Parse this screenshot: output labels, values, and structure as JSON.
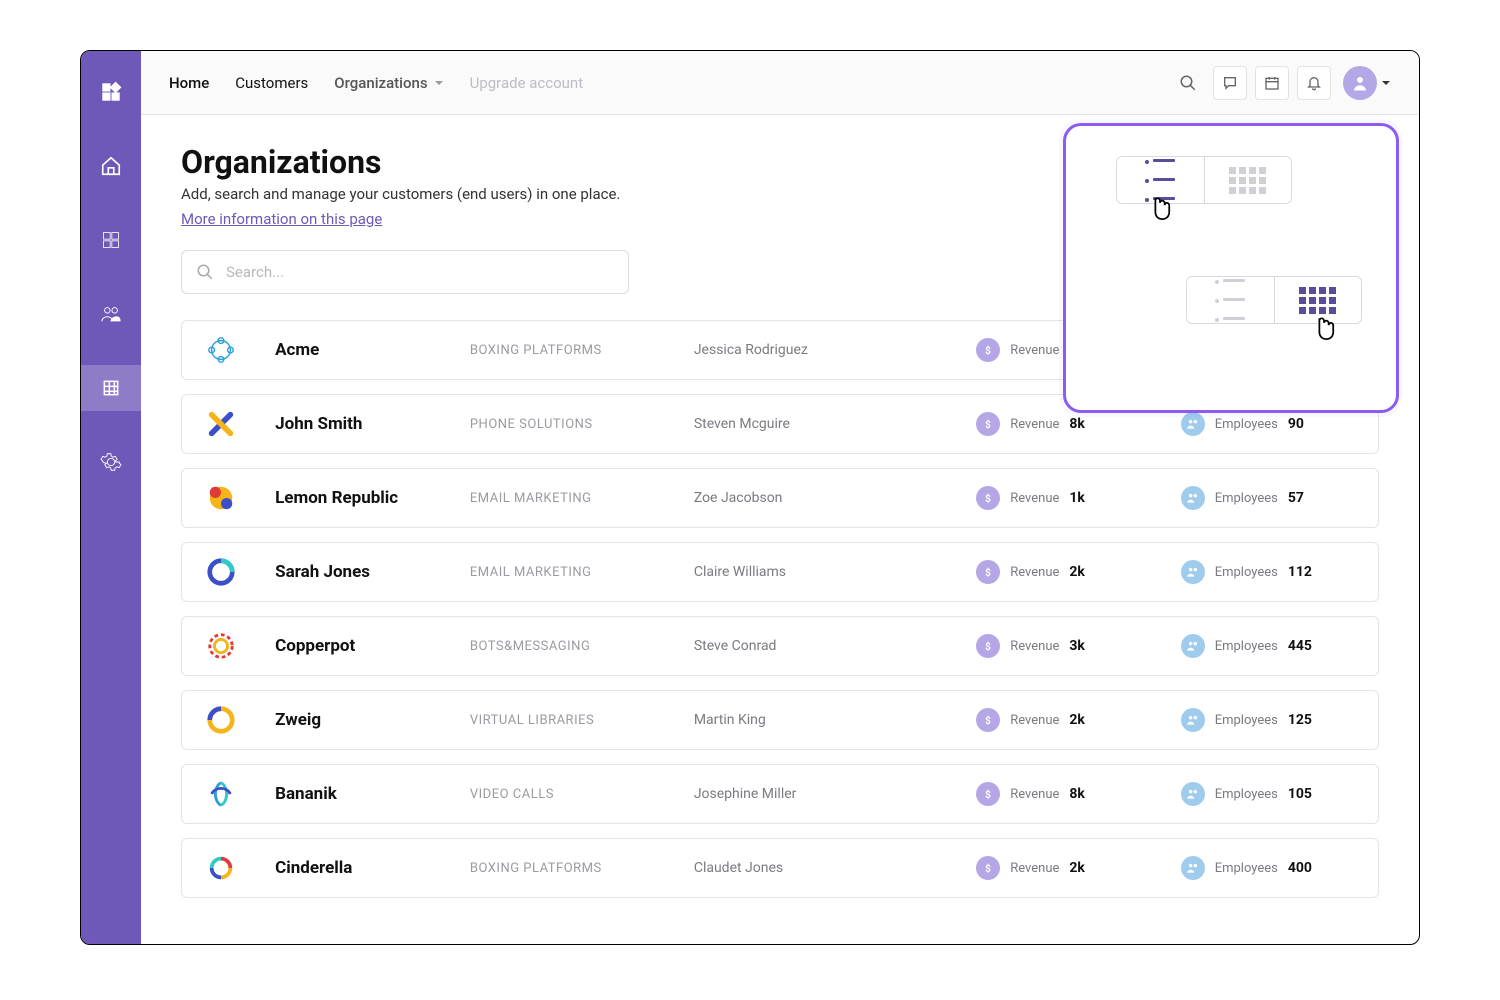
{
  "nav": {
    "items": [
      "Home",
      "Customers",
      "Organizations",
      "Upgrade account"
    ]
  },
  "page": {
    "title": "Organizations",
    "subtitle": "Add, search and manage your customers (end users) in one place.",
    "more_link": "More information on this page"
  },
  "search": {
    "placeholder": "Search..."
  },
  "labels": {
    "revenue": "Revenue",
    "employees": "Employees"
  },
  "orgs": [
    {
      "name": "Acme",
      "industry": "BOXING PLATFORMS",
      "contact": "Jessica Rodriguez",
      "revenue": "",
      "employees": ""
    },
    {
      "name": "John Smith",
      "industry": "PHONE SOLUTIONS",
      "contact": "Steven Mcguire",
      "revenue": "8k",
      "employees": "90"
    },
    {
      "name": "Lemon Republic",
      "industry": "EMAIL MARKETING",
      "contact": "Zoe Jacobson",
      "revenue": "1k",
      "employees": "57"
    },
    {
      "name": "Sarah Jones",
      "industry": "EMAIL MARKETING",
      "contact": "Claire Williams",
      "revenue": "2k",
      "employees": "112"
    },
    {
      "name": "Copperpot",
      "industry": "BOTS&MESSAGING",
      "contact": "Steve Conrad",
      "revenue": "3k",
      "employees": "445"
    },
    {
      "name": "Zweig",
      "industry": "VIRTUAL LIBRARIES",
      "contact": "Martin King",
      "revenue": "2k",
      "employees": "125"
    },
    {
      "name": "Bananik",
      "industry": "VIDEO CALLS",
      "contact": "Josephine Miller",
      "revenue": "8k",
      "employees": "105"
    },
    {
      "name": "Cinderella",
      "industry": "BOXING PLATFORMS",
      "contact": "Claudet Jones",
      "revenue": "2k",
      "employees": "400"
    }
  ]
}
